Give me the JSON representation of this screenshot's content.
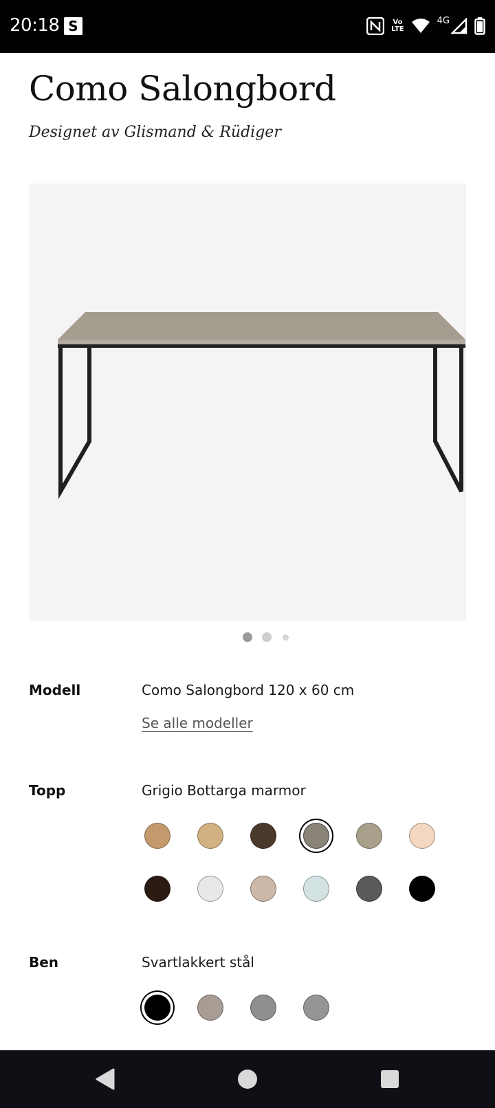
{
  "status_bar": {
    "time": "20:18",
    "app_badge": "S",
    "volte_top": "Vo",
    "volte_bottom": "LTE",
    "network": "4G",
    "icons": [
      "nfc-icon",
      "volte-icon",
      "wifi-icon",
      "cell-signal-icon",
      "battery-icon"
    ]
  },
  "product": {
    "title": "Como Salongbord",
    "subtitle": "Designet av Glismand & Rüdiger",
    "image_pages": 3,
    "active_page": 1
  },
  "model": {
    "label": "Modell",
    "value": "Como Salongbord 120 x 60 cm",
    "link": "Se alle modeller"
  },
  "top": {
    "label": "Topp",
    "value": "Grigio Bottarga marmor",
    "selected_index": 3,
    "swatches": [
      {
        "name": "oak-light",
        "color": "#c49a6c"
      },
      {
        "name": "oak-natural",
        "color": "#d2b283"
      },
      {
        "name": "walnut-dark",
        "color": "#4a3a2c"
      },
      {
        "name": "grigio-bottarga-marble",
        "color": "#8a8378"
      },
      {
        "name": "stone-sand",
        "color": "#a8a08a"
      },
      {
        "name": "peach",
        "color": "#f3d7c1"
      },
      {
        "name": "emperador-dark-marble",
        "color": "#2a1a12"
      },
      {
        "name": "white-grey",
        "color": "#e8e8e8"
      },
      {
        "name": "travertine",
        "color": "#cbb8a6"
      },
      {
        "name": "pale-mint",
        "color": "#d3e2e2"
      },
      {
        "name": "dark-grey-marble",
        "color": "#5a5a5c"
      },
      {
        "name": "black",
        "color": "#000000"
      }
    ]
  },
  "legs": {
    "label": "Ben",
    "value": "Svartlakkert stål",
    "selected_index": 0,
    "swatches": [
      {
        "name": "black-steel",
        "color": "#000000"
      },
      {
        "name": "taupe-steel",
        "color": "#a89c94"
      },
      {
        "name": "grey-steel",
        "color": "#8f8f8f"
      },
      {
        "name": "grey-steel-2",
        "color": "#959595"
      }
    ]
  },
  "nav": {
    "back": "back-icon",
    "home": "home-icon",
    "recents": "recents-icon"
  }
}
